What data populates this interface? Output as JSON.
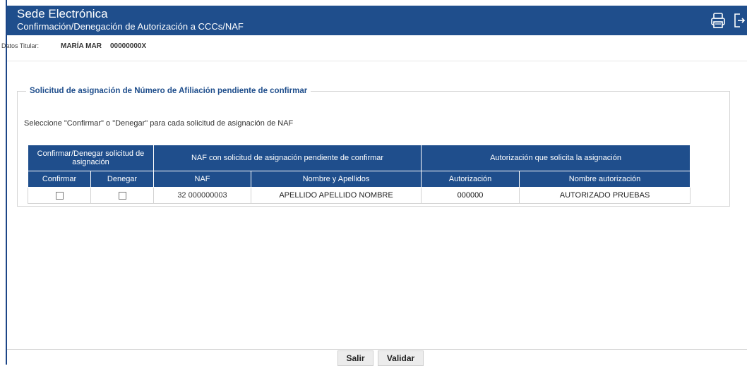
{
  "header": {
    "app_title": "Sede Electrónica",
    "subtitle": "Confirmación/Denegación de Autorización a CCCs/NAF",
    "icons": [
      "print-icon",
      "logout-icon"
    ]
  },
  "titular": {
    "label": "Datos Titular:",
    "name": "MARÍA MAR",
    "document": "00000000X"
  },
  "panel": {
    "legend": "Solicitud de asignación de Número de Afiliación pendiente de confirmar",
    "instruction": "Seleccione \"Confirmar\" o \"Denegar\" para cada solicitud de asignación de NAF"
  },
  "table": {
    "group_headers": [
      "Confirmar/Denegar solicitud de asignación",
      "NAF con solicitud de asignación pendiente de confirmar",
      "Autorización que solicita la asignación"
    ],
    "columns": [
      "Confirmar",
      "Denegar",
      "NAF",
      "Nombre y Apellidos",
      "Autorización",
      "Nombre autorización"
    ],
    "rows": [
      {
        "naf": "32 000000003",
        "nombre": "APELLIDO APELLIDO NOMBRE",
        "autorizacion": "000000",
        "nombre_autorizacion": "AUTORIZADO PRUEBAS"
      }
    ]
  },
  "buttons": {
    "salir": "Salir",
    "validar": "Validar"
  },
  "colors": {
    "header_bg": "#1f4e8c",
    "accent": "#1f4e8c"
  }
}
